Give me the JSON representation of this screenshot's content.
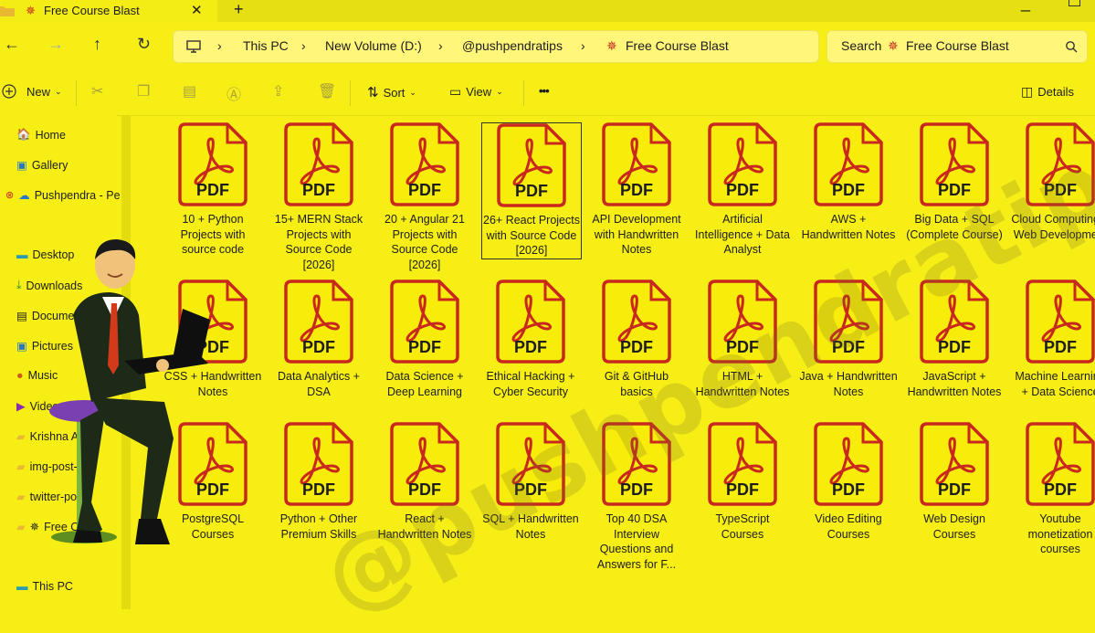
{
  "tab": {
    "title": "Free Course Blast",
    "close": "✕",
    "new_tab": "+"
  },
  "nav": {
    "back": "←",
    "forward": "→",
    "up": "↑",
    "refresh": "↻"
  },
  "breadcrumb": [
    "This PC",
    "New Volume (D:)",
    "@pushpendratips",
    "Free Course Blast"
  ],
  "search": {
    "placeholder": "Search",
    "scope": "Free Course Blast"
  },
  "toolbar": {
    "new": "New",
    "sort": "Sort",
    "view": "View",
    "more": "•••",
    "details": "Details"
  },
  "sidebar": {
    "items": [
      {
        "label": "Home",
        "icon": "home-icon"
      },
      {
        "label": "Gallery",
        "icon": "gallery-icon"
      },
      {
        "label": "Pushpendra - Pe",
        "icon": "cloud-icon"
      },
      {
        "label": "Desktop",
        "icon": "desktop-icon"
      },
      {
        "label": "Downloads",
        "icon": "download-icon"
      },
      {
        "label": "Documents",
        "icon": "documents-icon"
      },
      {
        "label": "Pictures",
        "icon": "pictures-icon"
      },
      {
        "label": "Music",
        "icon": "music-icon"
      },
      {
        "label": "Videos",
        "icon": "videos-icon"
      },
      {
        "label": "Krishna Ag",
        "icon": "folder-icon"
      },
      {
        "label": "img-post-to",
        "icon": "folder-icon"
      },
      {
        "label": "twitter-pos",
        "icon": "folder-icon"
      },
      {
        "label": "Free C",
        "icon": "folder-icon"
      },
      {
        "label": "This PC",
        "icon": "pc-icon"
      }
    ]
  },
  "files": [
    "10 + Python Projects with source code",
    "15+ MERN Stack Projects with Source Code [2026]",
    "20 + Angular 21 Projects with Source Code [2026]",
    "26+ React Projects with Source Code [2026]",
    "API Development with Handwritten Notes",
    "Artificial Intelligence + Data Analyst",
    "AWS + Handwritten Notes",
    "Big Data + SQL (Complete Course)",
    "Cloud Computing + Web Development",
    "CSS + Handwritten Notes",
    "Data Analytics + DSA",
    "Data Science + Deep Learning",
    "Ethical Hacking + Cyber Security",
    "Git & GitHub basics",
    "HTML + Handwritten Notes",
    "Java + Handwritten Notes",
    "JavaScript + Handwritten Notes",
    "Machine Learning + Data Science",
    "PostgreSQL Courses",
    "Python + Other Premium Skills",
    "React + Handwritten Notes",
    "SQL + Handwritten Notes",
    "Top 40 DSA Interview Questions and Answers for F...",
    "TypeScript Courses",
    "Video Editing Courses",
    "Web Design Courses",
    "Youtube monetization courses"
  ],
  "pdf_label": "PDF",
  "watermark": "@pushpendratips",
  "colors": {
    "background": "#f6ee15",
    "pdf_border": "#c8281e",
    "pdf_fill": "#f8ec0a"
  }
}
